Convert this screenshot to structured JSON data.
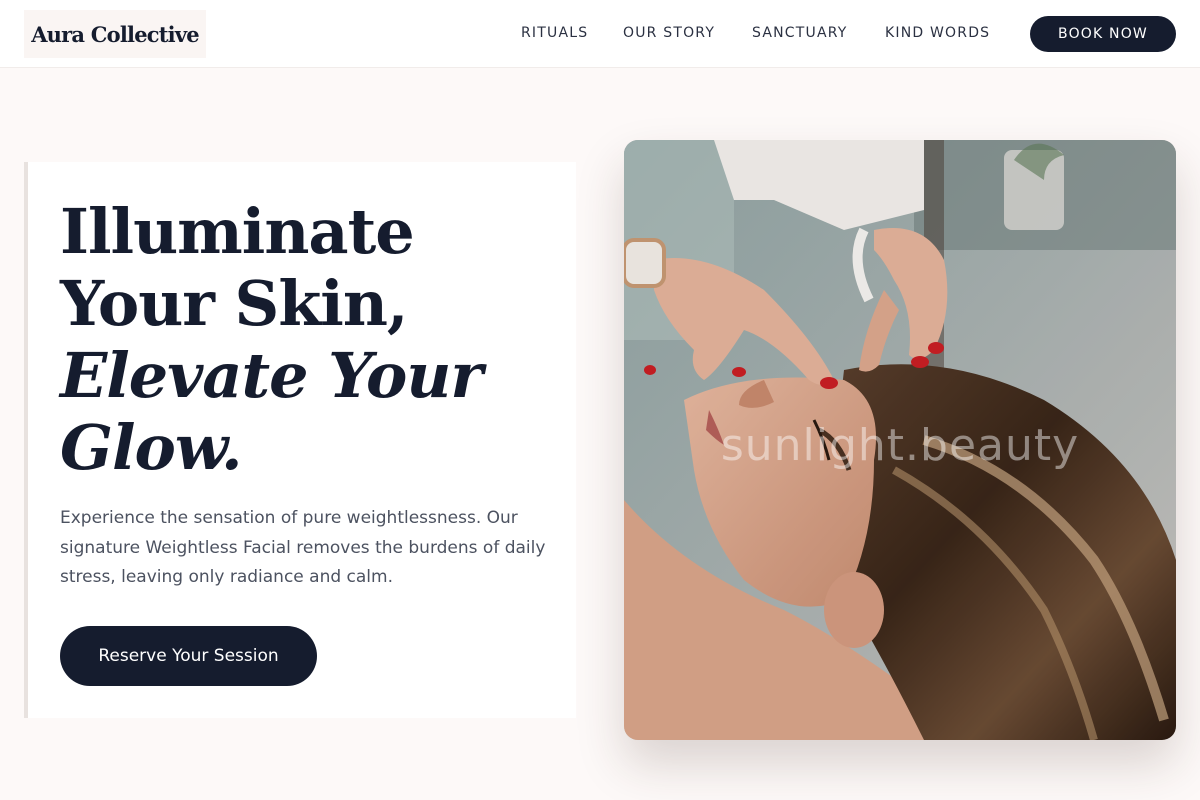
{
  "header": {
    "logo": "Aura Collective",
    "nav": [
      "RITUALS",
      "OUR STORY",
      "SANCTUARY",
      "KIND WORDS"
    ],
    "cta": "BOOK NOW"
  },
  "hero": {
    "headline_line1": "Illuminate",
    "headline_line2": "Your Skin,",
    "headline_line3": "Elevate Your",
    "headline_line4": "Glow.",
    "description": "Experience the sensation of pure weightlessness. Our signature Weightless Facial removes the burdens of daily stress, leaving only radiance and calm.",
    "button": "Reserve Your Session"
  },
  "image": {
    "watermark": "sunlight.beauty"
  },
  "colors": {
    "navy": "#151c2e",
    "background": "#fdf9f8",
    "accent_nails": "#c91f24"
  }
}
